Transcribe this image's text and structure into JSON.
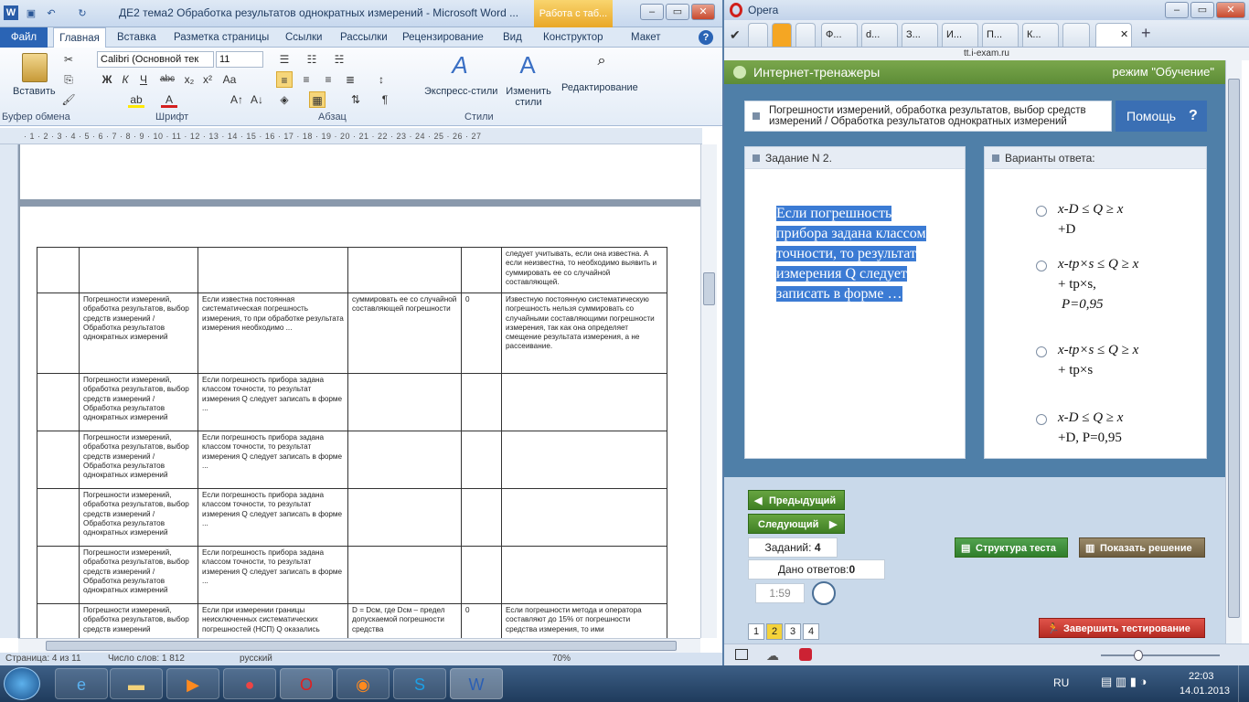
{
  "word": {
    "title": "ДЕ2 тема2 Обработка результатов однократных измерений  -  Microsoft Word ...",
    "context_tab": "Работа с таб...",
    "tabs": [
      "Файл",
      "Главная",
      "Вставка",
      "Разметка страницы",
      "Ссылки",
      "Рассылки",
      "Рецензирование",
      "Вид",
      "Конструктор",
      "Макет"
    ],
    "ribbon": {
      "paste": "Вставить",
      "font_name": "Calibri (Основной тек",
      "font_size": "11",
      "express_styles": "Экспресс-стили",
      "change_styles": "Изменить стили",
      "editing": "Редактирование",
      "groups": [
        "Буфер обмена",
        "Шрифт",
        "Абзац",
        "Стили"
      ]
    },
    "ruler": "· 1 · 2 · 3 · 4 · 5 · 6 · 7 · 8 · 9 · 10 · 11 · 12 · 13 · 14 · 15 · 16 · 17 · 18 · 19 · 20 · 21 · 22 · 23 · 24 · 25 · 26 · 27",
    "table": {
      "rows": [
        [
          "",
          "",
          "",
          "",
          "",
          "следует учитывать, если она известна. А если неизвестна, то необходимо выявить и суммировать ее со случайной составляющей."
        ],
        [
          "",
          "Погрешности измерений, обработка результатов, выбор средств измерений / Обработка результатов однократных измерений",
          "Если известна постоянная систематическая погрешность измерения, то при обработке результата измерения необходимо ...",
          "суммировать ее со случайной составляющей погрешности",
          "0",
          "Известную постоянную систематическую погрешность нельзя суммировать со случайными составляющими погрешности измерения, так как она определяет смещение результата измерения, а не рассеивание."
        ],
        [
          "",
          "Погрешности измерений, обработка результатов, выбор средств измерений / Обработка результатов однократных измерений",
          "Если погрешность прибора задана классом точности, то результат измерения Q следует записать в форме ...",
          "",
          "",
          ""
        ],
        [
          "",
          "Погрешности измерений, обработка результатов, выбор средств измерений / Обработка результатов однократных измерений",
          "Если погрешность прибора задана классом точности, то результат измерения Q следует записать в форме ...",
          "",
          "",
          ""
        ],
        [
          "",
          "Погрешности измерений, обработка результатов, выбор средств измерений / Обработка результатов однократных измерений",
          "Если погрешность прибора задана классом точности, то результат измерения Q следует записать в форме ...",
          "",
          "",
          ""
        ],
        [
          "",
          "Погрешности измерений, обработка результатов, выбор средств измерений / Обработка результатов однократных измерений",
          "Если погрешность прибора задана классом точности, то результат измерения Q следует записать в форме ...",
          "",
          "",
          ""
        ],
        [
          "",
          "Погрешности измерений, обработка результатов, выбор средств измерений",
          "Если при измерении границы неисключенных систематических погрешностей (НСП) Q оказались",
          "D = Dсм, где Dсм – предел допускаемой погрешности средства",
          "0",
          "Если погрешности метода и оператора составляют до 15% от погрешности средства измерения, то ими"
        ]
      ]
    },
    "status": {
      "page": "Страница: 4 из 11",
      "words": "Число слов: 1 812",
      "lang": "русский",
      "zoom": "70%"
    }
  },
  "opera": {
    "title": "Opera",
    "tabs": [
      "И...",
      "Ф...",
      "d...",
      "З...",
      "И...",
      "П...",
      "К...",
      "",
      ""
    ],
    "url": "tt.i-exam.ru",
    "site": {
      "header": "Интернет-тренажеры",
      "mode": "режим \"Обучение\"",
      "topic": "Погрешности измерений, обработка результатов, выбор средств измерений / Обработка результатов однократных измерений",
      "help": "Помощь",
      "task_title": "Задание N 2.",
      "question": "Если погрешность прибора задана классом точности, то результат измерения Q следует записать в форме …",
      "answers_title": "Варианты ответа:",
      "answers": [
        [
          "x-D ≤ Q ≥ x",
          "+D"
        ],
        [
          "x-tp×s ≤ Q ≥ x",
          "+ tp×s,",
          "P=0,95"
        ],
        [
          "x-tp×s ≤ Q ≥ x",
          "+ tp×s"
        ],
        [
          "x-D ≤ Q ≥ x",
          "+D,  P=0,95"
        ]
      ],
      "prev": "Предыдущий",
      "next": "Следующий",
      "tasks_label": "Заданий:",
      "tasks_count": "4",
      "answered_label": "Дано ответов:",
      "answered_count": "0",
      "timer": "1:59",
      "structure": "Структура теста",
      "show_solution": "Показать решение",
      "finish": "Завершить тестирование",
      "pages": [
        "1",
        "2",
        "3",
        "4"
      ],
      "current_page": "2"
    }
  },
  "taskbar": {
    "lang": "RU",
    "time": "22:03",
    "date": "14.01.2013"
  },
  "colors": {
    "question_highlight": "#3b7bd4",
    "site_bg": "#4f7fa8",
    "green": "#5d8c37"
  }
}
